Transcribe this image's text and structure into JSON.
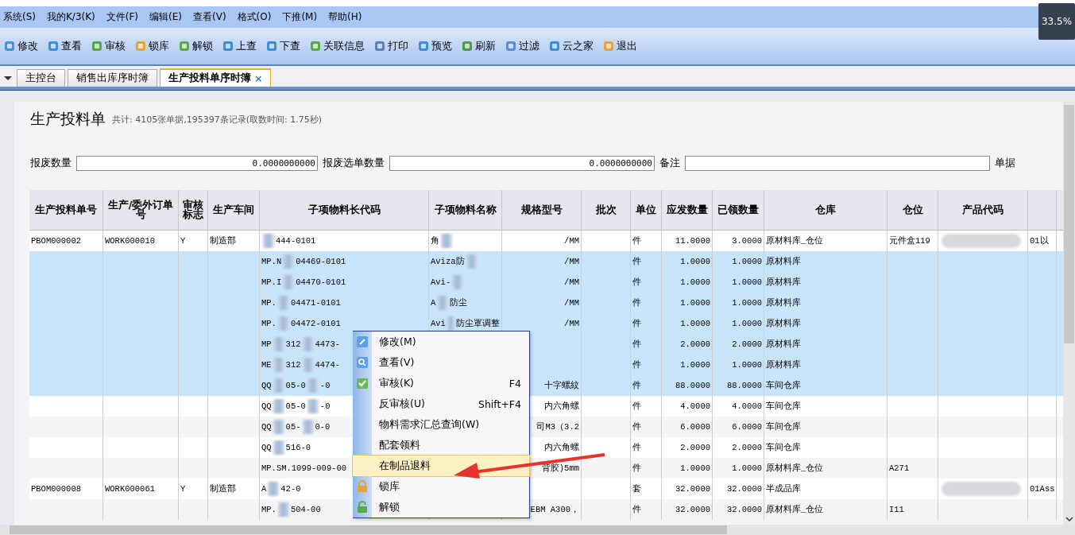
{
  "menu_bar": [
    "系统(S)",
    "我的K/3(K)",
    "文件(F)",
    "编辑(E)",
    "查看(V)",
    "格式(O)",
    "下推(M)",
    "帮助(H)"
  ],
  "toolbar": [
    "修改",
    "查看",
    "审核",
    "锁库",
    "解锁",
    "上查",
    "下查",
    "关联信息",
    "打印",
    "预览",
    "刷新",
    "过滤",
    "云之家",
    "退出"
  ],
  "tabs": [
    {
      "label": "主控台",
      "selected": false,
      "closable": false
    },
    {
      "label": "销售出库序时簿",
      "selected": false,
      "closable": false
    },
    {
      "label": "生产投料单序时簿",
      "selected": true,
      "closable": true,
      "close": "×"
    }
  ],
  "page": {
    "title": "生产投料单",
    "summary": "共计: 4105张单据,195397条记录(取数时间: 1.75秒)"
  },
  "filters": [
    {
      "kind": "field",
      "label": "报废数量",
      "value": "0.0000000000"
    },
    {
      "kind": "field",
      "label": "报废选单数量",
      "value": "0.0000000000"
    },
    {
      "kind": "field",
      "label": "备注"
    },
    {
      "kind": "label",
      "label": "单据"
    }
  ],
  "table": {
    "columns": [
      "生产投料单号",
      "生产/委外订单号",
      "审核标志",
      "生产车间",
      "子项物料长代码",
      "子项物料名称",
      "规格型号",
      "批次",
      "单位",
      "应发数量",
      "已领数量",
      "仓库",
      "仓位",
      "产品代码"
    ],
    "rows": [
      {
        "selected": false,
        "cells": [
          "PBOM000002",
          "WORK000010",
          "Y",
          "制造部",
          [
            null,
            "444-0101"
          ],
          [
            "角",
            null
          ],
          "/MM",
          "",
          "件",
          "11.0000",
          "3.0000",
          "原材料库_仓位",
          "元件盒119",
          [
            null
          ],
          "01以"
        ]
      },
      {
        "selected": true,
        "cells": [
          "",
          "",
          "",
          "",
          [
            "MP.N",
            null,
            "04469-0101"
          ],
          [
            "Aviza防",
            null
          ],
          "/MM",
          "",
          "件",
          "1.0000",
          "1.0000",
          "原材料库",
          "",
          "",
          ""
        ]
      },
      {
        "selected": true,
        "cells": [
          "",
          "",
          "",
          "",
          [
            "MP.I",
            null,
            "04470-0101"
          ],
          [
            "Avi-",
            null
          ],
          "/MM",
          "",
          "件",
          "1.0000",
          "1.0000",
          "原材料库",
          "",
          "",
          ""
        ]
      },
      {
        "selected": true,
        "cells": [
          "",
          "",
          "",
          "",
          [
            "MP.",
            null,
            "04471-0101"
          ],
          [
            "A",
            null,
            "防尘"
          ],
          "/MM",
          "",
          "件",
          "1.0000",
          "1.0000",
          "原材料库",
          "",
          "",
          ""
        ]
      },
      {
        "selected": true,
        "cells": [
          "",
          "",
          "",
          "",
          [
            "MP.",
            null,
            "04472-0101"
          ],
          [
            "Avi",
            null,
            "防尘罩调整"
          ],
          "/MM",
          "",
          "件",
          "1.0000",
          "1.0000",
          "原材料库",
          "",
          "",
          ""
        ]
      },
      {
        "selected": true,
        "cells": [
          "",
          "",
          "",
          "",
          [
            "MP",
            null,
            "312",
            null,
            "4473-"
          ],
          "",
          "",
          "",
          "件",
          "2.0000",
          "2.0000",
          "原材料库",
          "",
          "",
          ""
        ]
      },
      {
        "selected": true,
        "cells": [
          "",
          "",
          "",
          "",
          [
            "ME",
            null,
            "312",
            null,
            "4474-"
          ],
          "",
          "",
          "",
          "件",
          "1.0000",
          "1.0000",
          "原材料库",
          "",
          "",
          ""
        ]
      },
      {
        "selected": true,
        "cells": [
          "",
          "",
          "",
          "",
          [
            "QQ",
            null,
            "05-0",
            null,
            "-0"
          ],
          "",
          "十字螺紋",
          "",
          "件",
          "88.0000",
          "88.0000",
          "车间仓库",
          "",
          "",
          ""
        ]
      },
      {
        "selected": false,
        "cells": [
          "",
          "",
          "",
          "",
          [
            "QQ",
            null,
            "05-0",
            null,
            "-0"
          ],
          "",
          "内六角螺",
          "",
          "件",
          "4.0000",
          "4.0000",
          "车间仓库",
          "",
          "",
          ""
        ]
      },
      {
        "selected": false,
        "cells": [
          "",
          "",
          "",
          "",
          [
            "QQ",
            null,
            "05-",
            null,
            "0-0"
          ],
          "",
          "司M3（3.2",
          "",
          "件",
          "6.0000",
          "6.0000",
          "车间仓库",
          "",
          "",
          ""
        ]
      },
      {
        "selected": false,
        "cells": [
          "",
          "",
          "",
          "",
          [
            "QQ",
            null,
            "516-0"
          ],
          "",
          "内六角螺",
          "",
          "件",
          "2.0000",
          "2.0000",
          "车间仓库",
          "",
          "",
          ""
        ]
      },
      {
        "selected": false,
        "cells": [
          "",
          "",
          "",
          "",
          "MP.SM.1099-009-00",
          "",
          "背胶)5mm",
          "",
          "件",
          "1.0000",
          "1.0000",
          "原材料库_仓位",
          "A271",
          "",
          ""
        ]
      },
      {
        "selected": false,
        "cells": [
          "PBOM000008",
          "WORK000061",
          "Y",
          "制造部",
          [
            "A",
            null,
            "42-0"
          ],
          "",
          "",
          "",
          "套",
          "32.0000",
          "32.0000",
          "半成品库",
          "",
          [
            null
          ],
          "01Ass"
        ]
      },
      {
        "selected": false,
        "cells": [
          "",
          "",
          "",
          "",
          [
            "MP.",
            null,
            "504-00"
          ],
          "",
          "EBM A300，",
          "",
          "件",
          "32.0000",
          "32.0000",
          "原材料库_仓位",
          "I11",
          "",
          ""
        ]
      }
    ]
  },
  "context_menu": {
    "items": [
      {
        "label": "修改(M)",
        "selected": false
      },
      {
        "label": "查看(V)",
        "selected": false
      },
      {
        "label": "审核(K)",
        "shortcut": "F4",
        "selected": false
      },
      {
        "label": "反审核(U)",
        "shortcut": "Shift+F4",
        "selected": false
      },
      {
        "label": "物料需求汇总查询(W)",
        "selected": false
      },
      {
        "label": "配套领料",
        "selected": false
      },
      {
        "label": "在制品退料",
        "selected": true
      },
      {
        "label": "锁库",
        "selected": false
      },
      {
        "label": "解锁",
        "selected": false
      }
    ]
  },
  "zoom_badge": "33.5%"
}
